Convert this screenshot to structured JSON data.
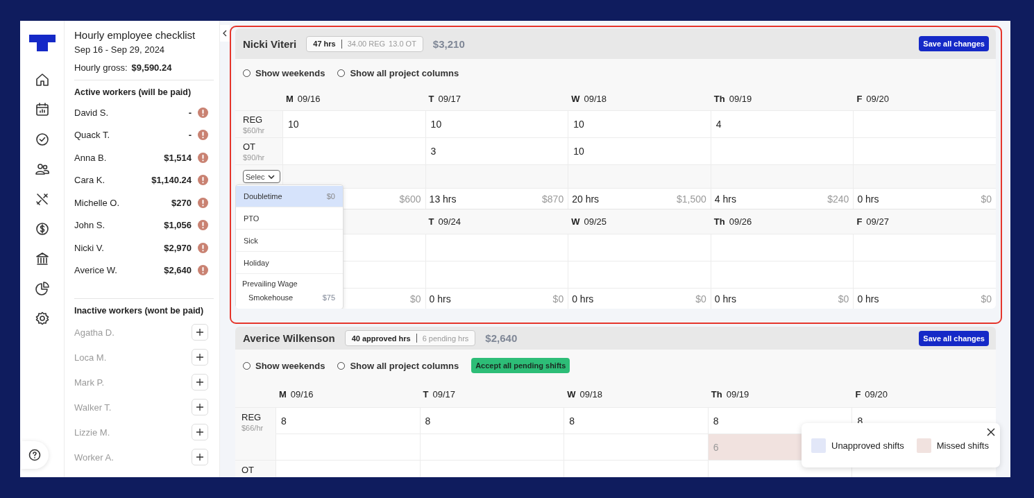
{
  "sidebar": {
    "title": "Hourly employee checklist",
    "date_range": "Sep 16 - Sep 29, 2024",
    "gross_label": "Hourly gross:",
    "gross_value": "$9,590.24",
    "active_heading": "Active workers (will be paid)",
    "active_workers": [
      {
        "name": "David S.",
        "amount": "-",
        "warning": true
      },
      {
        "name": "Quack T.",
        "amount": "-",
        "warning": true
      },
      {
        "name": "Anna B.",
        "amount": "$1,514",
        "warning": true
      },
      {
        "name": "Cara K.",
        "amount": "$1,140.24",
        "warning": true
      },
      {
        "name": "Michelle O.",
        "amount": "$270",
        "warning": true
      },
      {
        "name": "John S.",
        "amount": "$1,056",
        "warning": true
      },
      {
        "name": "Nicki V.",
        "amount": "$2,970",
        "warning": true
      },
      {
        "name": "Averice W.",
        "amount": "$2,640",
        "warning": true
      }
    ],
    "inactive_heading": "Inactive workers (wont be paid)",
    "inactive_workers": [
      {
        "name": "Agatha D."
      },
      {
        "name": "Loca M."
      },
      {
        "name": "Mark P."
      },
      {
        "name": "Walker T."
      },
      {
        "name": "Lizzie M."
      },
      {
        "name": "Worker A."
      }
    ]
  },
  "employees": [
    {
      "name": "Nicki Viteri",
      "highlighted": true,
      "summary": {
        "main": "47 hrs",
        "details": [
          "34.00 REG",
          "13.0 OT"
        ]
      },
      "total": "$3,210",
      "save_label": "Save all changes",
      "options": [
        {
          "label": "Show weekends",
          "checked": false
        },
        {
          "label": "Show all project columns",
          "checked": false
        }
      ],
      "weeks": [
        {
          "days": {
            "mon": {
              "dow": "M",
              "date": "09/16"
            },
            "tue": {
              "dow": "T",
              "date": "09/17"
            },
            "wed": {
              "dow": "W",
              "date": "09/18"
            },
            "thu": {
              "dow": "Th",
              "date": "09/19"
            },
            "fri": {
              "dow": "F",
              "date": "09/20"
            }
          },
          "rows": [
            {
              "label": "REG",
              "rate": "$60/hr",
              "lines": [
                {
                  "mon": {
                    "value": "10"
                  },
                  "tue": {
                    "value": "10"
                  },
                  "wed": {
                    "value": "10"
                  },
                  "thu": {
                    "value": "4"
                  }
                }
              ]
            },
            {
              "label": "OT",
              "rate": "$90/hr",
              "lines": [
                {
                  "tue": {
                    "value": "3"
                  },
                  "wed": {
                    "value": "10"
                  }
                }
              ]
            }
          ],
          "select": {
            "value": "Selec",
            "expanded": true,
            "options": [
              {
                "kind": "option",
                "label": "Doubletime",
                "amount": "$0",
                "selected": true
              },
              {
                "kind": "option",
                "label": "PTO",
                "selected": false
              },
              {
                "kind": "option",
                "label": "Sick",
                "selected": false
              },
              {
                "kind": "option",
                "label": "Holiday",
                "selected": false
              },
              {
                "kind": "group",
                "label": "Prevailing Wage"
              },
              {
                "kind": "sub",
                "label": "Smokehouse",
                "amount": "$75",
                "selected": false
              }
            ]
          },
          "totals": {
            "mon": {
              "amount": "$600"
            },
            "tue": {
              "hours": "13 hrs",
              "amount": "$870"
            },
            "wed": {
              "hours": "20 hrs",
              "amount": "$1,500"
            },
            "thu": {
              "hours": "4 hrs",
              "amount": "$240"
            },
            "fri": {
              "hours": "0 hrs",
              "amount": "$0"
            }
          }
        },
        {
          "days": {
            "tue": {
              "dow": "T",
              "date": "09/24"
            },
            "wed": {
              "dow": "W",
              "date": "09/25"
            },
            "thu": {
              "dow": "Th",
              "date": "09/26"
            },
            "fri": {
              "dow": "F",
              "date": "09/27"
            }
          },
          "totals": {
            "mon": {
              "amount": "$0"
            },
            "tue": {
              "hours": "0 hrs",
              "amount": "$0"
            },
            "wed": {
              "hours": "0 hrs",
              "amount": "$0"
            },
            "thu": {
              "hours": "0 hrs",
              "amount": "$0"
            },
            "fri": {
              "hours": "0 hrs",
              "amount": "$0"
            }
          }
        }
      ]
    },
    {
      "name": "Averice Wilkenson",
      "highlighted": false,
      "summary": {
        "main": "40 approved hrs",
        "details": [
          "6 pending hrs"
        ]
      },
      "total": "$2,640",
      "save_label": "Save all changes",
      "options": [
        {
          "label": "Show weekends",
          "checked": false
        },
        {
          "label": "Show all project columns",
          "checked": false
        }
      ],
      "accept_label": "Accept all pending shifts",
      "weeks": [
        {
          "days": {
            "mon": {
              "dow": "M",
              "date": "09/16"
            },
            "tue": {
              "dow": "T",
              "date": "09/17"
            },
            "wed": {
              "dow": "W",
              "date": "09/18"
            },
            "thu": {
              "dow": "Th",
              "date": "09/19"
            },
            "fri": {
              "dow": "F",
              "date": "09/20"
            }
          },
          "rows": [
            {
              "label": "REG",
              "rate": "$66/hr",
              "lines": [
                {
                  "mon": {
                    "value": "8"
                  },
                  "tue": {
                    "value": "8"
                  },
                  "wed": {
                    "value": "8"
                  },
                  "thu": {
                    "value": "8"
                  },
                  "fri": {
                    "value": "8"
                  }
                },
                {
                  "thu": {
                    "value": "6",
                    "missed": true
                  }
                }
              ]
            },
            {
              "label": "OT"
            }
          ]
        }
      ]
    }
  ],
  "legend": {
    "items": [
      {
        "label": "Unapproved shifts",
        "color": "#e2e7f8"
      },
      {
        "label": "Missed shifts",
        "color": "#f1e2df"
      }
    ]
  }
}
